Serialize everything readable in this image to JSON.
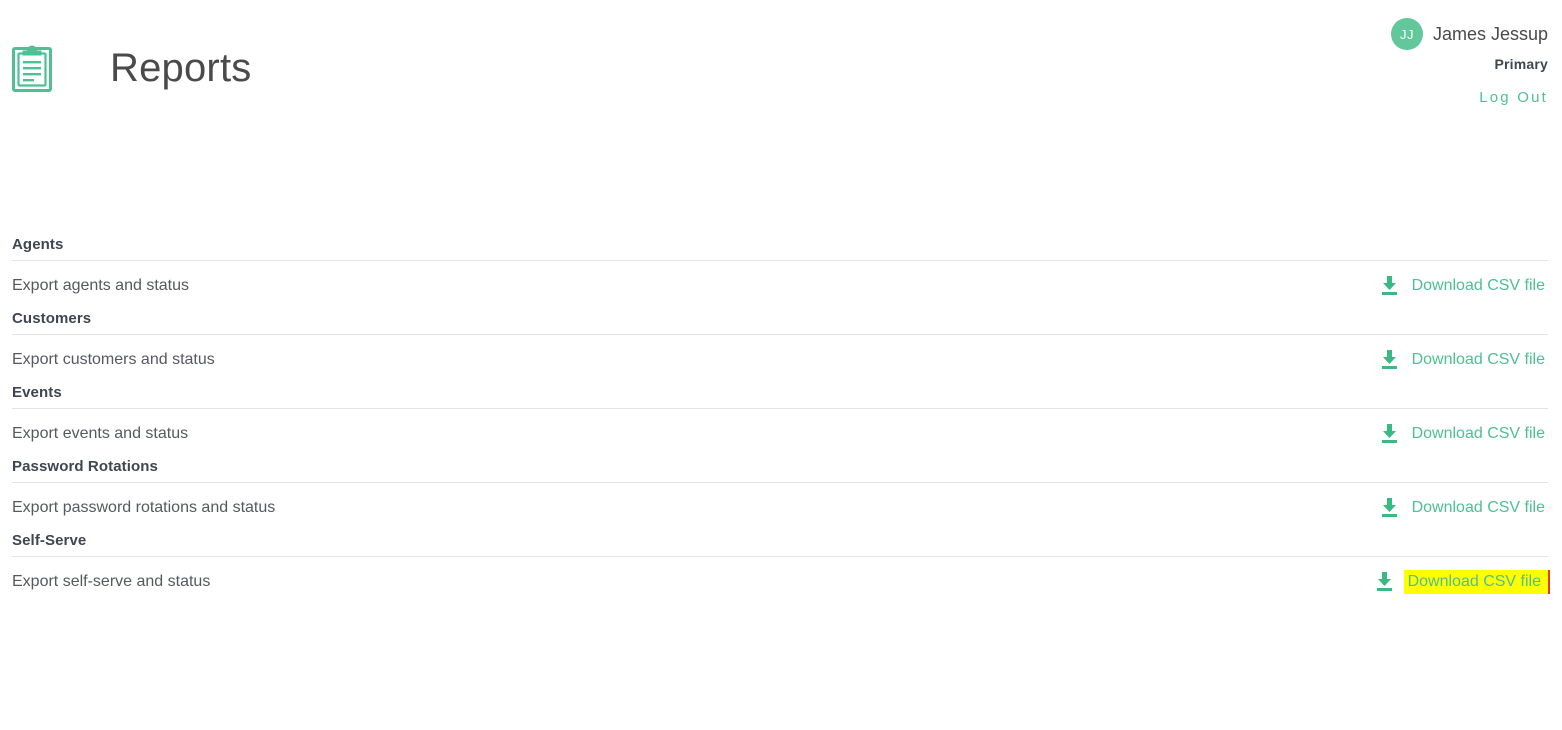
{
  "header": {
    "icon": "clipboard-icon",
    "title": "Reports",
    "user": {
      "avatar_initials": "JJ",
      "name": "James Jessup",
      "role": "Primary",
      "logout_label": "Log Out"
    }
  },
  "colors": {
    "accent_green": "#4ec094",
    "avatar_green": "#62c79b",
    "title_gray": "#4a4a4a",
    "label_gray": "#56595e",
    "header_gray": "#3f4650",
    "divider": "#e3e3e3",
    "highlight_yellow": "#ffff00",
    "highlight_border_red": "#e53b2e"
  },
  "sections": [
    {
      "title": "Agents",
      "row_label": "Export agents and status",
      "link_label": "Download CSV file",
      "link_icon": "download-icon",
      "highlighted": false
    },
    {
      "title": "Customers",
      "row_label": "Export customers and status",
      "link_label": "Download CSV file",
      "link_icon": "download-icon",
      "highlighted": false
    },
    {
      "title": "Events",
      "row_label": "Export events and status",
      "link_label": "Download CSV file",
      "link_icon": "download-icon",
      "highlighted": false
    },
    {
      "title": "Password Rotations",
      "row_label": "Export password rotations and status",
      "link_label": "Download CSV file",
      "link_icon": "download-icon",
      "highlighted": false
    },
    {
      "title": "Self-Serve",
      "row_label": "Export self-serve and status",
      "link_label": "Download CSV file",
      "link_icon": "download-icon",
      "highlighted": true
    }
  ]
}
